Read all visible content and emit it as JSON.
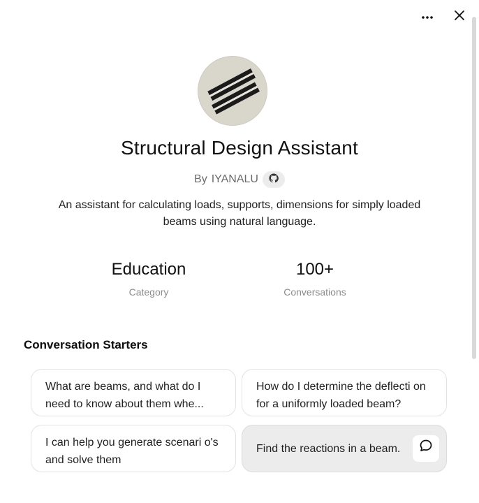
{
  "header": {
    "more_icon": "more-horizontal-icon",
    "close_icon": "close-icon"
  },
  "profile": {
    "title": "Structural Design Assistant",
    "by_prefix": "By",
    "author": "IYANALU",
    "author_icon": "github-icon",
    "description": "An assistant for calculating loads, supports, dimensions for simply loaded beams using natural language."
  },
  "stats": [
    {
      "value": "Education",
      "label": "Category"
    },
    {
      "value": "100+",
      "label": "Conversations"
    }
  ],
  "starters": {
    "heading": "Conversation Starters",
    "items": [
      {
        "text": "What are beams, and what do I need to know about them whe..."
      },
      {
        "text": "How do I determine the deflecti on for a uniformly loaded beam?"
      },
      {
        "text": "I can help you generate scenari o's and solve them"
      },
      {
        "text": "Find the reactions in a beam.",
        "icon": "chat-bubble-icon"
      }
    ]
  },
  "colors": {
    "avatar_bg": "#d9d7cc",
    "card_border": "#e3e3e3",
    "active_card_bg": "#ececec"
  }
}
